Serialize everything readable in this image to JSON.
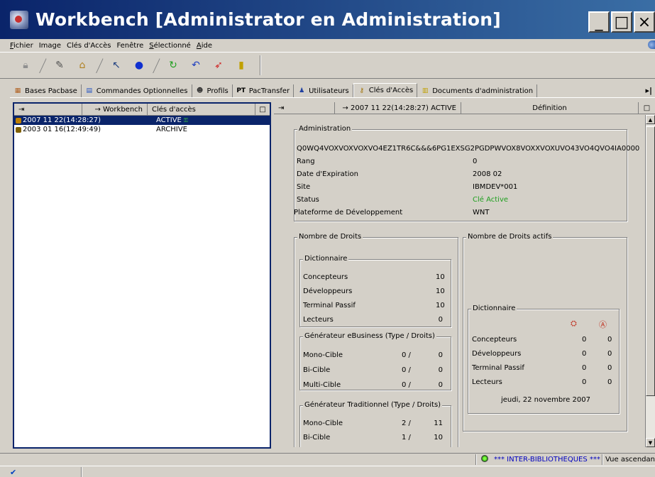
{
  "window": {
    "title": "Workbench [Administrator en Administration]",
    "minimize": "_",
    "maximize": "□",
    "close": "×"
  },
  "menu": [
    {
      "label": "Fichier",
      "u": "F",
      "rest": "ichier"
    },
    {
      "label": "Image",
      "u": "",
      "rest": "Image"
    },
    {
      "label": "Clés d'Accès",
      "u": "",
      "rest": "Clés d'Accès"
    },
    {
      "label": "Fenêtre",
      "u": "",
      "rest": "Fenêtre"
    },
    {
      "label": "Sélectionné",
      "u": "S",
      "rest": "électionné"
    },
    {
      "label": "Aide",
      "u": "A",
      "rest": "ide"
    }
  ],
  "tabs": [
    {
      "label": "Bases Pacbase",
      "icon": "database-icon",
      "glyph": "▦"
    },
    {
      "label": "Commandes Optionnelles",
      "icon": "document-icon",
      "glyph": "▤"
    },
    {
      "label": "Profils",
      "icon": "profile-icon",
      "glyph": "☻"
    },
    {
      "label": "PacTransfer",
      "icon": "transfer-icon",
      "glyph": "PT"
    },
    {
      "label": "Utilisateurs",
      "icon": "users-icon",
      "glyph": "♟"
    },
    {
      "label": "Clés d'Accès",
      "icon": "key-icon",
      "glyph": "⚷",
      "active": true
    },
    {
      "label": "Documents d'administration",
      "icon": "folder-doc-icon",
      "glyph": "▥"
    }
  ],
  "left_pane": {
    "headers": [
      "⇥",
      "→ Workbench",
      "Clés d'accès",
      "□"
    ],
    "rows": [
      {
        "date": "2007 11 22(14:28:27)",
        "status": "ACTIVE",
        "selected": true
      },
      {
        "date": "2003 01 16(12:49:49)",
        "status": "ARCHIVE",
        "selected": false
      }
    ]
  },
  "right_pane": {
    "headers": [
      "⇥",
      "→ 2007 11 22(14:28:27) ACTIVE",
      "Définition",
      "□"
    ],
    "administration": {
      "title": "Administration",
      "key": "Q0WQ4VOXVOXVOXVO4EZ1TR6C&&&6PG1EXSG2PGDPWVOX8VOXXVOXUVO43VO4QVO4IA0000",
      "rows": [
        {
          "label": "Rang",
          "value": "0"
        },
        {
          "label": "Date d'Expiration",
          "value": "2008 02"
        },
        {
          "label": "Site",
          "value": "IBMDEV*001"
        },
        {
          "label": "Status",
          "value": "Clé Active",
          "color": "#20a020"
        },
        {
          "label": "Plateforme de Développement",
          "value": "WNT"
        }
      ]
    },
    "droits": {
      "title": "Nombre de Droits",
      "dictionnaire": {
        "title": "Dictionnaire",
        "rows": [
          {
            "label": "Concepteurs",
            "value": "10"
          },
          {
            "label": "Développeurs",
            "value": "10"
          },
          {
            "label": "Terminal Passif",
            "value": "10"
          },
          {
            "label": "Lecteurs",
            "value": "0"
          }
        ]
      },
      "ebusiness": {
        "title": "Générateur eBusiness (Type / Droits)",
        "rows": [
          {
            "label": "Mono-Cible",
            "a": "0 /",
            "b": "0"
          },
          {
            "label": "Bi-Cible",
            "a": "0 /",
            "b": "0"
          },
          {
            "label": "Multi-Cible",
            "a": "0 /",
            "b": "0"
          }
        ]
      },
      "traditionnel": {
        "title": "Générateur Traditionnel (Type / Droits)",
        "rows": [
          {
            "label": "Mono-Cible",
            "a": "2 /",
            "b": "11"
          },
          {
            "label": "Bi-Cible",
            "a": "1 /",
            "b": "10"
          }
        ]
      }
    },
    "droits_actifs": {
      "title": "Nombre de Droits actifs",
      "dictionnaire": {
        "title": "Dictionnaire",
        "rows": [
          {
            "label": "Concepteurs",
            "a": "0",
            "b": "0"
          },
          {
            "label": "Développeurs",
            "a": "0",
            "b": "0"
          },
          {
            "label": "Terminal Passif",
            "a": "0",
            "b": "0"
          },
          {
            "label": "Lecteurs",
            "a": "0",
            "b": "0"
          }
        ],
        "date": "jeudi, 22 novembre 2007"
      }
    }
  },
  "status": {
    "libraries": "*** INTER-BIBLIOTHEQUES ***",
    "sort": "Vue ascendant"
  }
}
